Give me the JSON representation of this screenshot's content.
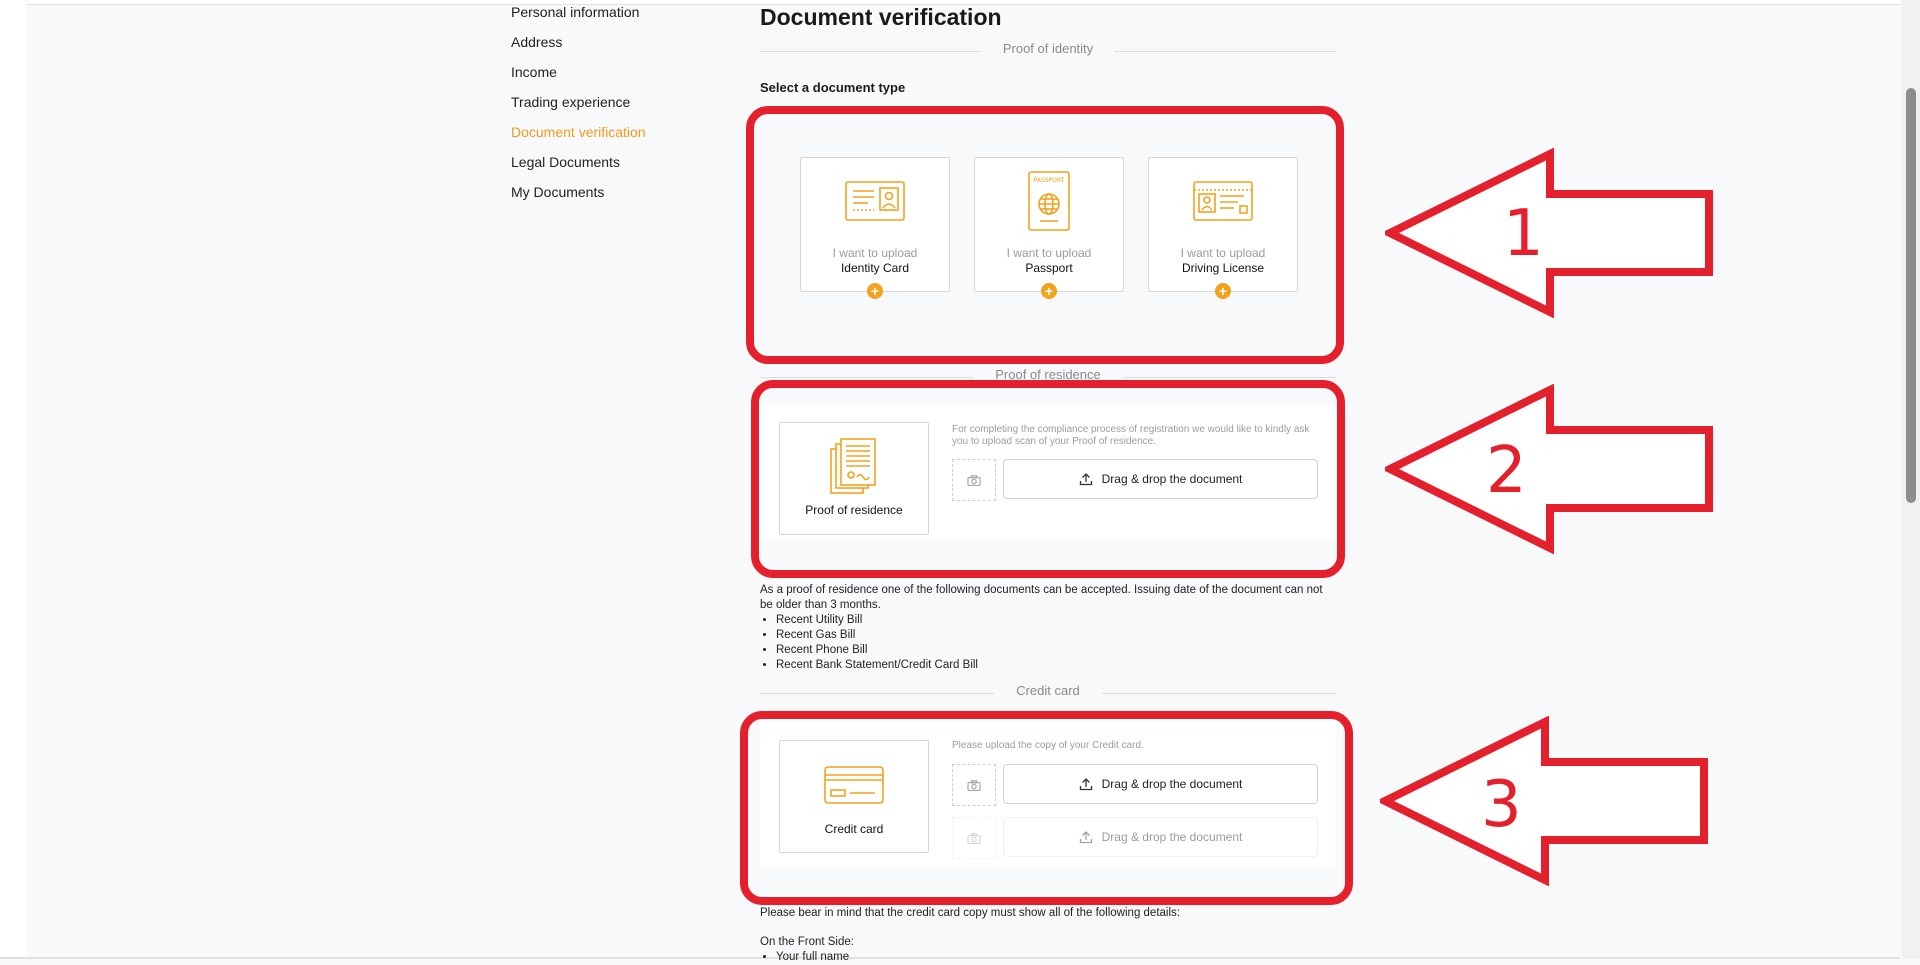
{
  "sidebar": {
    "items": [
      {
        "label": "Personal information"
      },
      {
        "label": "Address"
      },
      {
        "label": "Income"
      },
      {
        "label": "Trading experience"
      },
      {
        "label": "Document verification",
        "active": true
      },
      {
        "label": "Legal Documents"
      },
      {
        "label": "My Documents"
      }
    ]
  },
  "main": {
    "title": "Document verification",
    "identity": {
      "section_label": "Proof of identity",
      "select_title": "Select a document type",
      "cards": [
        {
          "sub": "I want to upload",
          "name": "Identity Card",
          "icon": "identity-card-icon"
        },
        {
          "sub": "I want to upload",
          "name": "Passport",
          "icon": "passport-icon",
          "icon_text": "PASSPORT"
        },
        {
          "sub": "I want to upload",
          "name": "Driving License",
          "icon": "driving-license-icon"
        }
      ]
    },
    "residence": {
      "section_label": "Proof of residence",
      "card_name": "Proof of residence",
      "note": "For completing the compliance process of registration we would like to kindly ask you to upload scan of your Proof of residence.",
      "drop_label": "Drag & drop the document",
      "info_text": "As a proof of residence one of the following documents can be accepted. Issuing date of the document can not be older than 3 months.",
      "accepted": [
        "Recent Utility Bill",
        "Recent Gas Bill",
        "Recent Phone Bill",
        "Recent Bank Statement/Credit Card Bill"
      ]
    },
    "credit_card": {
      "section_label": "Credit card",
      "card_name": "Credit card",
      "note": "Please upload the copy of your Credit card.",
      "drop_label_front": "Drag & drop the document",
      "drop_label_back": "Drag & drop the document",
      "info_text": "Please bear in mind that the credit card copy must show all of the following details:",
      "front_side_label": "On the Front Side:",
      "front_items": [
        "Your full name"
      ]
    }
  },
  "annotations": [
    {
      "number": "1"
    },
    {
      "number": "2"
    },
    {
      "number": "3"
    }
  ],
  "colors": {
    "accent": "#f39a1c",
    "annotation": "#e4202c"
  }
}
